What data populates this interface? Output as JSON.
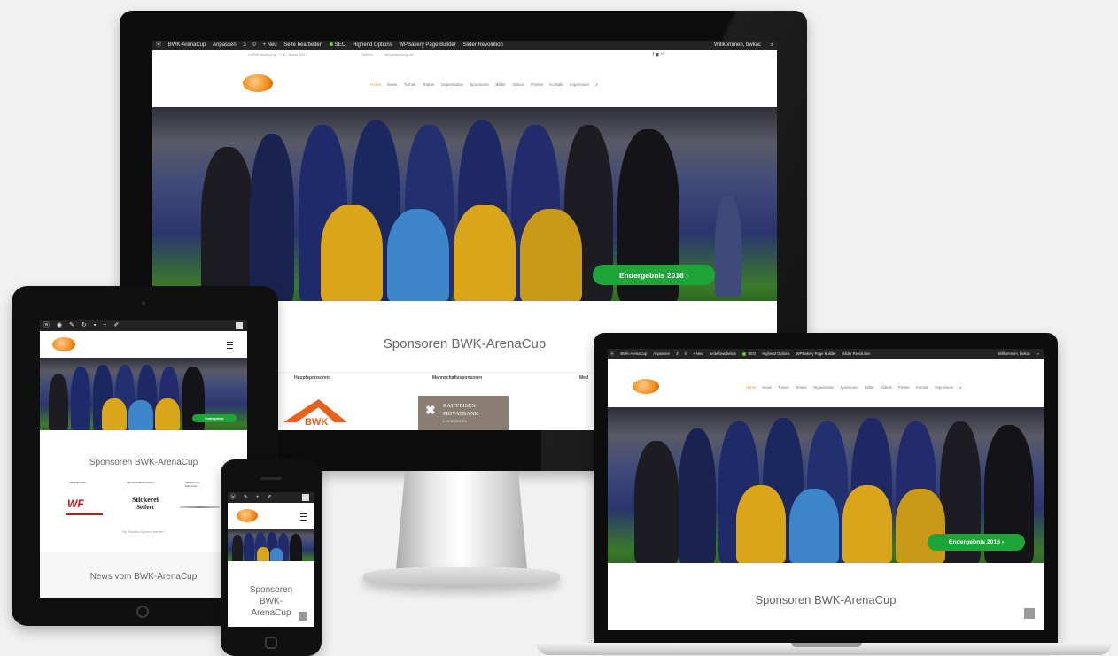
{
  "desktop": {
    "adminbar": {
      "items": [
        "BWK-ArenaCup",
        "Anpassen",
        "3",
        "0",
        "+ Neu",
        "Seite bearbeiten",
        "SEO",
        "Highend Options",
        "WPBakery Page Builder",
        "Slider Revolution"
      ],
      "greeting": "Willkommen, bwkac"
    },
    "topinfo": {
      "address": "4 BWK-ArenaCup · 7.-8. Jänner 2017",
      "phone": "Telefon",
      "email": "info@arenacup.de"
    },
    "nav": [
      "Home",
      "News",
      "Turnier",
      "Teams",
      "Organisation",
      "Sponsoren",
      "Bilder",
      "Videos",
      "Presse",
      "Kontakt",
      "Impressum"
    ],
    "cta": "Endergebnis 2016  ›",
    "sponsors_title": "Sponsoren BWK-ArenaCup",
    "sponsor_columns": [
      "Hauptsponsoren",
      "Mannschaftssponsoren",
      "Med"
    ],
    "sponsor_logos": {
      "bwk": "BWK",
      "raiffeisen_1": "RAIFFEISEN",
      "raiffeisen_2": "PRIVATBANK",
      "raiffeisen_3": "Liechtenstein"
    }
  },
  "tablet": {
    "sponsors_title": "Sponsoren BWK-ArenaCup",
    "sponsor_columns": [
      "Hauptsponsor",
      "Mannschaftssponsoren",
      "Medien- und Partnersp."
    ],
    "logos": {
      "wf": "WF",
      "stickerei_1": "Stickerei",
      "stickerei_2": "Seifert"
    },
    "small_text": "Sie Möchtest Sponsor werden?",
    "news_title": "News vom BWK-ArenaCup",
    "cta": "Endergebnis"
  },
  "phone": {
    "sponsors_title_1": "Sponsoren",
    "sponsors_title_2": "BWK-",
    "sponsors_title_3": "ArenaCup"
  },
  "laptop": {
    "adminbar": {
      "items": [
        "BWK-ArenaCup",
        "Anpassen",
        "3",
        "0",
        "+ Neu",
        "Seite bearbeiten",
        "SEO",
        "Highend Options",
        "WPBakery Page Builder",
        "Slider Revolution"
      ],
      "greeting": "Willkommen, bwkac"
    },
    "nav": [
      "Home",
      "News",
      "Turnier",
      "Teams",
      "Organisation",
      "Sponsoren",
      "Bilder",
      "Videos",
      "Presse",
      "Kontakt",
      "Impressum"
    ],
    "cta": "Endergebnis 2016  ›",
    "sponsors_title": "Sponsoren BWK-ArenaCup"
  },
  "colors": {
    "accent": "#f39019",
    "cta": "#1da53a",
    "adminbar": "#232323"
  }
}
